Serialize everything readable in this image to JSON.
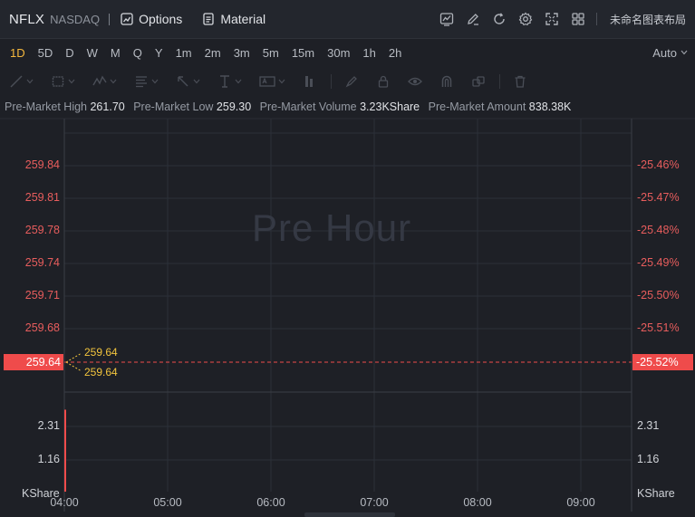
{
  "header": {
    "symbol": "NFLX",
    "exchange": "NASDAQ",
    "options_label": "Options",
    "material_label": "Material",
    "layout_label": "未命名图表布局"
  },
  "timeframes": {
    "items": [
      "1D",
      "5D",
      "D",
      "W",
      "M",
      "Q",
      "Y",
      "1m",
      "2m",
      "3m",
      "5m",
      "15m",
      "30m",
      "1h",
      "2h"
    ],
    "active": "1D",
    "auto_label": "Auto"
  },
  "info": {
    "high_label": "Pre-Market High",
    "high_value": "261.70",
    "low_label": "Pre-Market Low",
    "low_value": "259.30",
    "volume_label": "Pre-Market Volume",
    "volume_value": "3.23KShare",
    "amount_label": "Pre-Market Amount",
    "amount_value": "838.38K"
  },
  "chart": {
    "watermark": "Pre Hour",
    "price_ticks": [
      "259.84",
      "259.81",
      "259.78",
      "259.74",
      "259.71",
      "259.68"
    ],
    "pct_ticks": [
      "-25.46%",
      "-25.47%",
      "-25.48%",
      "-25.49%",
      "-25.50%",
      "-25.51%"
    ],
    "current_price": "259.64",
    "current_pct": "-25.52%",
    "annotation_high": "259.64",
    "annotation_low": "259.64",
    "volume_ticks": [
      "2.31",
      "1.16"
    ],
    "volume_unit": "KShare",
    "time_ticks": [
      "04:00",
      "05:00",
      "06:00",
      "07:00",
      "08:00",
      "09:00"
    ]
  },
  "chart_data": {
    "type": "line",
    "title": "Pre Hour",
    "y_range": [
      259.64,
      259.84
    ],
    "price_line": {
      "value": 259.64,
      "pct": "-25.52%"
    },
    "volume": {
      "unit": "KShare",
      "x": [
        "04:00"
      ],
      "values": [
        3.0
      ],
      "ticks": [
        2.31,
        1.16
      ]
    },
    "x_ticks": [
      "04:00",
      "05:00",
      "06:00",
      "07:00",
      "08:00",
      "09:00"
    ],
    "colors": {
      "up": "#ef4b4b",
      "annotation": "#f2c43d",
      "background": "#1e2026",
      "grid": "#2c3038"
    }
  }
}
